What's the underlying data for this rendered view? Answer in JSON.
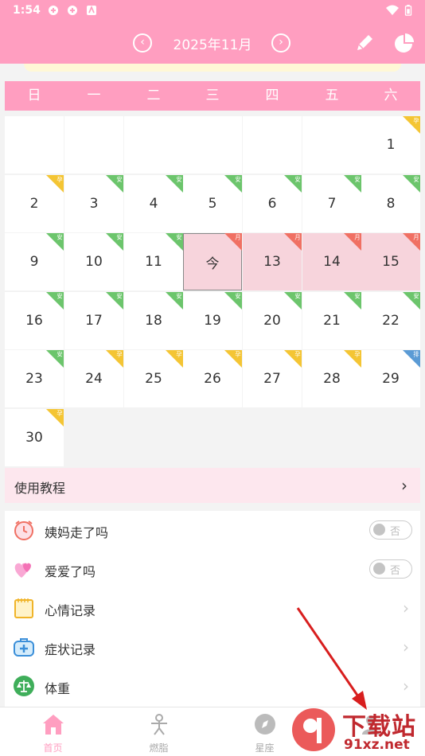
{
  "status_bar": {
    "time": "1:54"
  },
  "nav": {
    "prev_icon": "chevron-left-icon",
    "title": "2025年11月",
    "next_icon": "chevron-right-icon",
    "edit_icon": "pencil-icon",
    "stats_icon": "pie-chart-icon"
  },
  "weekdays": [
    "日",
    "一",
    "二",
    "三",
    "四",
    "五",
    "六"
  ],
  "calendar": {
    "days": [
      {
        "label": "1",
        "tag": "孕",
        "tagColor": "#f4c534"
      },
      {
        "label": "2",
        "tag": "孕",
        "tagColor": "#f4c534"
      },
      {
        "label": "3",
        "tag": "安",
        "tagColor": "#6cc56c"
      },
      {
        "label": "4",
        "tag": "安",
        "tagColor": "#6cc56c"
      },
      {
        "label": "5",
        "tag": "安",
        "tagColor": "#6cc56c"
      },
      {
        "label": "6",
        "tag": "安",
        "tagColor": "#6cc56c"
      },
      {
        "label": "7",
        "tag": "安",
        "tagColor": "#6cc56c"
      },
      {
        "label": "8",
        "tag": "安",
        "tagColor": "#6cc56c"
      },
      {
        "label": "9",
        "tag": "安",
        "tagColor": "#6cc56c"
      },
      {
        "label": "10",
        "tag": "安",
        "tagColor": "#6cc56c"
      },
      {
        "label": "11",
        "tag": "安",
        "tagColor": "#6cc56c"
      },
      {
        "label": "今",
        "tag": "月",
        "tagColor": "#f07063"
      },
      {
        "label": "13",
        "tag": "月",
        "tagColor": "#f07063"
      },
      {
        "label": "14",
        "tag": "月",
        "tagColor": "#f07063"
      },
      {
        "label": "15",
        "tag": "月",
        "tagColor": "#f07063"
      },
      {
        "label": "16",
        "tag": "安",
        "tagColor": "#6cc56c"
      },
      {
        "label": "17",
        "tag": "安",
        "tagColor": "#6cc56c"
      },
      {
        "label": "18",
        "tag": "安",
        "tagColor": "#6cc56c"
      },
      {
        "label": "19",
        "tag": "安",
        "tagColor": "#6cc56c"
      },
      {
        "label": "20",
        "tag": "安",
        "tagColor": "#6cc56c"
      },
      {
        "label": "21",
        "tag": "安",
        "tagColor": "#6cc56c"
      },
      {
        "label": "22",
        "tag": "安",
        "tagColor": "#6cc56c"
      },
      {
        "label": "23",
        "tag": "安",
        "tagColor": "#6cc56c"
      },
      {
        "label": "24",
        "tag": "孕",
        "tagColor": "#f4c534"
      },
      {
        "label": "25",
        "tag": "孕",
        "tagColor": "#f4c534"
      },
      {
        "label": "26",
        "tag": "孕",
        "tagColor": "#f4c534"
      },
      {
        "label": "27",
        "tag": "孕",
        "tagColor": "#f4c534"
      },
      {
        "label": "28",
        "tag": "孕",
        "tagColor": "#f4c534"
      },
      {
        "label": "29",
        "tag": "排",
        "tagColor": "#5b9bd5"
      },
      {
        "label": "30",
        "tag": "孕",
        "tagColor": "#f4c534"
      }
    ],
    "period_days": [
      "今",
      "13",
      "14",
      "15"
    ],
    "today_label": "今"
  },
  "tutorial": {
    "label": "使用教程"
  },
  "records": [
    {
      "label": "姨妈走了吗",
      "icon": "alarm-clock-icon",
      "toggle": "否"
    },
    {
      "label": "爱爱了吗",
      "icon": "hearts-icon",
      "toggle": "否"
    },
    {
      "label": "心情记录",
      "icon": "notepad-icon"
    },
    {
      "label": "症状记录",
      "icon": "medical-kit-icon"
    },
    {
      "label": "体重",
      "icon": "scale-icon"
    }
  ],
  "tabs": [
    {
      "label": "首页",
      "icon": "home-icon",
      "active": true
    },
    {
      "label": "燃脂",
      "icon": "fitness-icon",
      "active": false
    },
    {
      "label": "星座",
      "icon": "compass-icon",
      "active": false
    },
    {
      "label": "",
      "icon": "profile-icon",
      "active": false
    }
  ],
  "watermark": {
    "title": "下载站",
    "site": "91xz.net"
  },
  "colors": {
    "accent": "#ff9ec0",
    "safe": "#6cc56c",
    "pregnant": "#f4c534",
    "menstrual": "#f07063",
    "ovulation": "#5b9bd5"
  }
}
